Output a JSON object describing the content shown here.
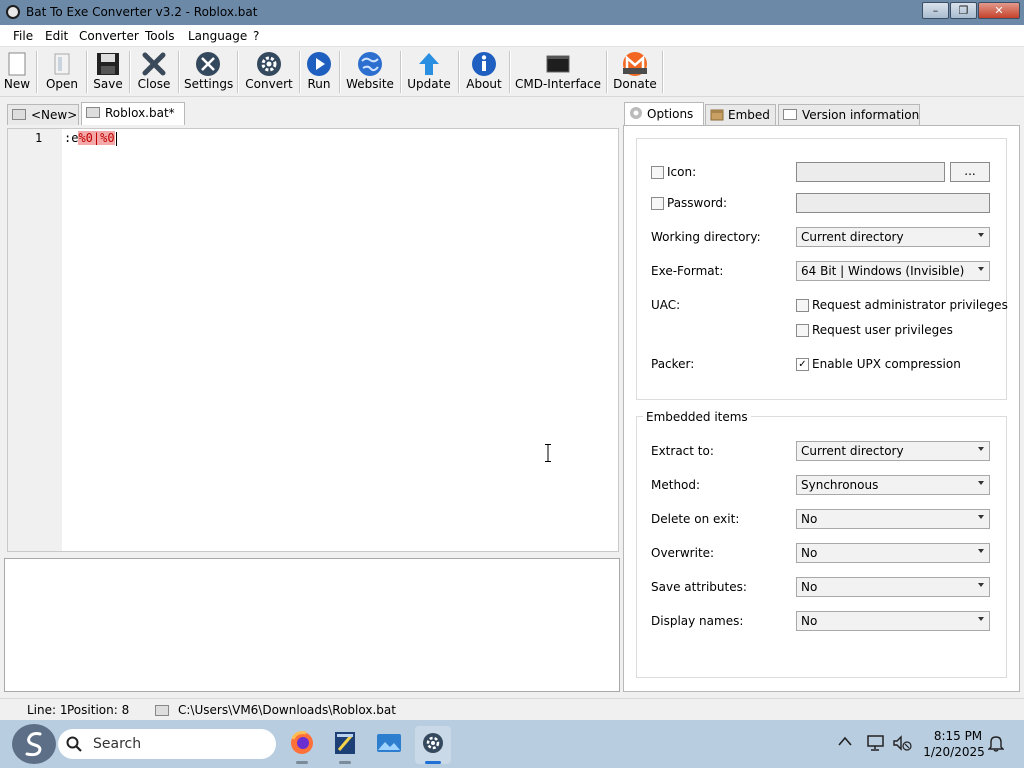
{
  "window": {
    "title": "Bat To Exe Converter v3.2 - Roblox.bat",
    "controls": {
      "minimize": "–",
      "maximize": "❐",
      "close": "✕"
    }
  },
  "menu": [
    "File",
    "Edit",
    "Converter",
    "Tools",
    "Language",
    "?"
  ],
  "toolbar": [
    {
      "label": "New",
      "icon": "new-file-icon"
    },
    {
      "label": "Open",
      "icon": "open-folder-icon"
    },
    {
      "label": "Save",
      "icon": "floppy-icon"
    },
    {
      "label": "Close",
      "icon": "close-x-icon"
    },
    {
      "label": "Settings",
      "icon": "settings-icon"
    },
    {
      "label": "Convert",
      "icon": "gear-icon"
    },
    {
      "label": "Run",
      "icon": "play-icon"
    },
    {
      "label": "Website",
      "icon": "globe-icon"
    },
    {
      "label": "Update",
      "icon": "arrow-up-icon"
    },
    {
      "label": "About",
      "icon": "info-icon"
    },
    {
      "label": "CMD-Interface",
      "icon": "terminal-icon"
    },
    {
      "label": "Donate",
      "icon": "monero-icon"
    }
  ],
  "editor_tabs": [
    "<New>",
    "Roblox.bat*"
  ],
  "editor": {
    "line_number": "1",
    "code_prefix": ":e",
    "code_highlight": "%0|%0"
  },
  "right_tabs": [
    "Options",
    "Embed",
    "Version information"
  ],
  "options": {
    "icon_label": "Icon:",
    "browse_label": "...",
    "password_label": "Password:",
    "working_dir_label": "Working directory:",
    "working_dir_value": "Current directory",
    "exe_format_label": "Exe-Format:",
    "exe_format_value": "64 Bit | Windows (Invisible)",
    "uac_label": "UAC:",
    "uac_admin": "Request administrator privileges",
    "uac_user": "Request user privileges",
    "packer_label": "Packer:",
    "upx_label": "Enable UPX compression",
    "upx_checked": true,
    "icon_checked": false,
    "password_checked": false
  },
  "embedded": {
    "title": "Embedded items",
    "extract_label": "Extract to:",
    "extract_value": "Current directory",
    "method_label": "Method:",
    "method_value": "Synchronous",
    "delete_label": "Delete on exit:",
    "delete_value": "No",
    "overwrite_label": "Overwrite:",
    "overwrite_value": "No",
    "save_attr_label": "Save attributes:",
    "save_attr_value": "No",
    "display_names_label": "Display names:",
    "display_names_value": "No"
  },
  "status": {
    "line": "Line: 1",
    "position": "Position: 8",
    "path": "C:\\Users\\VM6\\Downloads\\Roblox.bat"
  },
  "taskbar": {
    "search_placeholder": "Search",
    "time": "8:15 PM",
    "date": "1/20/2025"
  }
}
